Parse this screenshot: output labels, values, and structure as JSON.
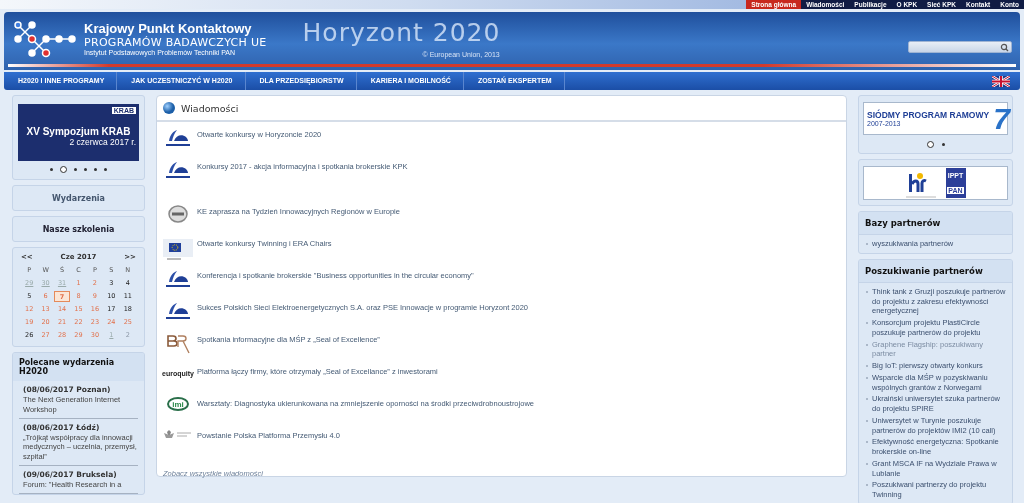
{
  "top_links": [
    {
      "label": "Strona główna",
      "selected": true
    },
    {
      "label": "Wiadomości",
      "selected": false
    },
    {
      "label": "Publikacje",
      "selected": false
    },
    {
      "label": "O KPK",
      "selected": false
    },
    {
      "label": "Sieć KPK",
      "selected": false
    },
    {
      "label": "Kontakt",
      "selected": false
    },
    {
      "label": "Konto",
      "selected": false
    }
  ],
  "header": {
    "title": "Krajowy Punkt Kontaktowy",
    "subtitle": "PROGRAMÓW BADAWCZYCH UE",
    "institute": "Instytut Podstawowych Problemów Techniki PAN",
    "banner_text": "Horyzont 2020",
    "banner_caption": "© European Union, 2013"
  },
  "nav": {
    "items": [
      "H2020 I INNE PROGRAMY",
      "JAK UCZESTNICZYĆ W H2020",
      "DLA PRZEDSIĘBIORSTW",
      "KARIERA I MOBILNOŚĆ",
      "ZOSTAŃ EKSPERTEM"
    ]
  },
  "left": {
    "slider": {
      "logo": "KRAB",
      "title": "XV Sympozjum KRAB",
      "date": "2 czerwca 2017 r.",
      "dots": [
        {
          "selected": false
        },
        {
          "selected": true
        },
        {
          "selected": false
        },
        {
          "selected": false
        },
        {
          "selected": false
        },
        {
          "selected": false
        }
      ]
    },
    "buttons": [
      "Wydarzenia",
      "Nasze szkolenia"
    ],
    "calendar": {
      "prev": "<<",
      "month": "Cze 2017",
      "next": ">>",
      "weekdays": [
        "P",
        "W",
        "Ś",
        "C",
        "P",
        "S",
        "N"
      ],
      "days": [
        {
          "text": "29",
          "kind": "other",
          "selected": false
        },
        {
          "text": "30",
          "kind": "other",
          "selected": false
        },
        {
          "text": "31",
          "kind": "other",
          "selected": false
        },
        {
          "text": "1",
          "kind": "event",
          "selected": false
        },
        {
          "text": "2",
          "kind": "event",
          "selected": false
        },
        {
          "text": "3",
          "kind": "plain",
          "selected": false
        },
        {
          "text": "4",
          "kind": "plain",
          "selected": false
        },
        {
          "text": "5",
          "kind": "plain",
          "selected": false
        },
        {
          "text": "6",
          "kind": "event",
          "selected": false
        },
        {
          "text": "7",
          "kind": "event",
          "selected": true
        },
        {
          "text": "8",
          "kind": "event",
          "selected": false
        },
        {
          "text": "9",
          "kind": "event",
          "selected": false
        },
        {
          "text": "10",
          "kind": "plain",
          "selected": false
        },
        {
          "text": "11",
          "kind": "plain",
          "selected": false
        },
        {
          "text": "12",
          "kind": "event",
          "selected": false
        },
        {
          "text": "13",
          "kind": "event",
          "selected": false
        },
        {
          "text": "14",
          "kind": "event",
          "selected": false
        },
        {
          "text": "15",
          "kind": "event",
          "selected": false
        },
        {
          "text": "16",
          "kind": "event",
          "selected": false
        },
        {
          "text": "17",
          "kind": "plain",
          "selected": false
        },
        {
          "text": "18",
          "kind": "plain",
          "selected": false
        },
        {
          "text": "19",
          "kind": "event",
          "selected": false
        },
        {
          "text": "20",
          "kind": "event",
          "selected": false
        },
        {
          "text": "21",
          "kind": "event",
          "selected": false
        },
        {
          "text": "22",
          "kind": "event",
          "selected": false
        },
        {
          "text": "23",
          "kind": "event",
          "selected": false
        },
        {
          "text": "24",
          "kind": "event",
          "selected": false
        },
        {
          "text": "25",
          "kind": "event",
          "selected": false
        },
        {
          "text": "26",
          "kind": "plain",
          "selected": false
        },
        {
          "text": "27",
          "kind": "event",
          "selected": false
        },
        {
          "text": "28",
          "kind": "event",
          "selected": false
        },
        {
          "text": "29",
          "kind": "event",
          "selected": false
        },
        {
          "text": "30",
          "kind": "event",
          "selected": false
        },
        {
          "text": "1",
          "kind": "other",
          "selected": false
        },
        {
          "text": "2",
          "kind": "faded",
          "selected": false
        }
      ]
    },
    "featured": {
      "title": "Polecane wydarzenia H2020",
      "items": [
        {
          "date": "(08/06/2017 Poznan)",
          "text": "The Next Generation Internet Workshop"
        },
        {
          "date": "(08/06/2017 Łódź)",
          "text": "„Trójkąt współpracy dla innowacji medycznych – uczelnia, przemysł, szpital”"
        },
        {
          "date": "(09/06/2017 Bruksela)",
          "text": "Forum: \"Health Research in a"
        }
      ]
    }
  },
  "news": {
    "title": "Wiadomości",
    "items": [
      {
        "kind": "horyzont",
        "text": "Otwarte konkursy w Horyzoncie 2020"
      },
      {
        "kind": "horyzont",
        "text": "Konkursy 2017 - akcja informacyjna i spotkania brokerskie KPK"
      },
      {
        "kind": "badge",
        "text": "KE zaprasza na Tydzień Innowacyjnych Regionów w Europie"
      },
      {
        "kind": "eu",
        "text": "Otwarte konkursy Twinning i ERA Chairs"
      },
      {
        "kind": "horyzont",
        "text": "Konferencja i spotkanie brokerskie \"Business opportunities in the circular economy\""
      },
      {
        "kind": "horyzont",
        "text": "Sukces Polskich Sieci Elektroenergetycznych S.A. oraz PSE Innowacje w programie Horyzont 2020"
      },
      {
        "kind": "br",
        "text": "Spotkania informacyjne dla MŚP z „Seal of Excellence”"
      },
      {
        "kind": "wordmark",
        "logo_text": "euroquity",
        "text": "Platforma łączy firmy, które otrzymały „Seal of Excellance” z inwestorami"
      },
      {
        "kind": "oval",
        "logo_text": "imi",
        "text": "Warsztaty: Diagnostyka ukierunkowana na zmniejszenie oporności na środki przeciwdrobnoustrojowe"
      },
      {
        "kind": "emblem",
        "text": "Powstanie Polska Platforma Przemysłu 4.0"
      }
    ],
    "more": "Zobacz wszystkie wiadomości"
  },
  "right": {
    "banner": {
      "title": "SIÓDMY PROGRAM RAMOWY",
      "years": "2007-2013",
      "number": "7",
      "dots": [
        {
          "selected": true
        },
        {
          "selected": false
        }
      ]
    },
    "logos": {
      "ippt": "IPPT",
      "pan": "PAN"
    },
    "bases": {
      "title": "Bazy partnerów",
      "items": [
        {
          "text": "wyszukiwania partnerów",
          "visited": false
        }
      ]
    },
    "search": {
      "title": "Poszukiwanie partnerów",
      "items": [
        {
          "text": "Think tank z Gruzji poszukuje partnerów do projektu z zakresu efektywności energetycznej",
          "visited": false
        },
        {
          "text": "Konsorcjum projektu PlastiCircle poszukuje partnerów do projektu",
          "visited": false
        },
        {
          "text": "Graphene Flagship: poszukiwany partner",
          "visited": true
        },
        {
          "text": "Big IoT: pierwszy otwarty konkurs",
          "visited": false
        },
        {
          "text": "Wsparcie dla MŚP w pozyskiwaniu wspólnych grantów z Norwegami",
          "visited": false
        },
        {
          "text": "Ukraiński uniwersytet szuka partnerów do projektu SPIRE",
          "visited": false
        },
        {
          "text": "Uniwersytet w Turynie poszukuje partnerów do projektów IMI2 (10 call)",
          "visited": false
        },
        {
          "text": "Efektywność energetyczna: Spotkanie brokerskie on-line",
          "visited": false
        },
        {
          "text": "Grant MSCA IF na Wydziale Prawa w Lublanie",
          "visited": false
        },
        {
          "text": "Poszukiwani partnerzy do projektu Twinning",
          "visited": false
        }
      ]
    }
  }
}
